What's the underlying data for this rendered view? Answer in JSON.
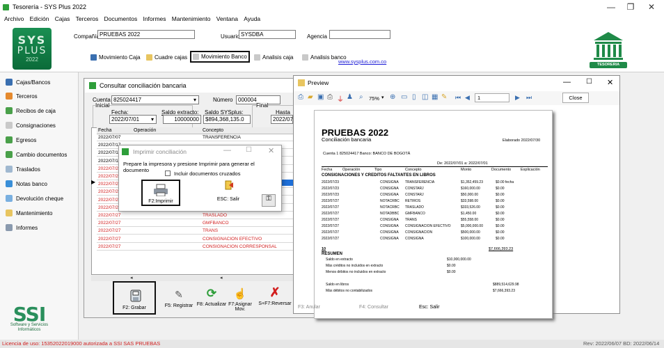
{
  "window": {
    "title": "Tesorería - SYS Plus 2022",
    "minimize": "—",
    "maximize": "❐",
    "close": "✕"
  },
  "menu": [
    "Archivo",
    "Edición",
    "Cajas",
    "Terceros",
    "Documentos",
    "Informes",
    "Mantenimiento",
    "Ventana",
    "Ayuda"
  ],
  "logo": {
    "line1": "SYS",
    "line2": "PLUS",
    "line3": "2022"
  },
  "header": {
    "company_label": "Compañía",
    "company_value": "PRUEBAS 2022",
    "user_label": "Usuario",
    "user_value": "SYSDBA",
    "agency_label": "Agencia",
    "agency_value": "",
    "nav": [
      "Movimiento Caja",
      "Cuadre cajas",
      "Movimiento Banco",
      "Analisis caja",
      "Analisis banco"
    ],
    "website": "www.sysplus.com.co",
    "right_logo": "TESORERIA"
  },
  "sidebar": [
    "Cajas/Bancos",
    "Terceros",
    "Recibos de caja",
    "Consignaciones",
    "Egresos",
    "Cambio documentos",
    "Traslados",
    "Notas banco",
    "Devolución cheque",
    "Mantenimiento",
    "Informes"
  ],
  "ssi": {
    "brand": "SSI",
    "caption": "Software y Servicios Informáticos"
  },
  "status": {
    "left": "Licencia de uso: 15352022019000 autorizada a SSI SAS PRUEBAS",
    "right": "Rev: 2022/06/07 BD: 2022/06/14"
  },
  "conc": {
    "title": "Consultar conciliación bancaria",
    "cuenta_label": "Cuenta",
    "cuenta_value": "825024417",
    "numero_label": "Número",
    "numero_value": "000004",
    "inicial_label": "Inicial",
    "final_label": "Final",
    "fecha_label": "Fecha:",
    "fecha_value": "2022/07/01",
    "saldo_extracto_label": "Saldo extracto:",
    "saldo_extracto_value": "10000000",
    "saldo_sys_label": "Saldo SYSplus:",
    "saldo_sys_value": "$894,368,135.0",
    "hasta_label": "Hasta",
    "hasta_value": "2022/07/",
    "columns": [
      "Fecha",
      "Operación",
      "Concepto"
    ],
    "rows": [
      {
        "fecha": "2022/07/07",
        "concepto": "TRANSFERENCIA",
        "red": false
      },
      {
        "fecha": "2022/07/17",
        "concepto": "",
        "red": false
      },
      {
        "fecha": "2022/07/17",
        "concepto": "",
        "red": false
      },
      {
        "fecha": "2022/07/17",
        "concepto": "",
        "red": false
      },
      {
        "fecha": "2022/07/23",
        "concepto": "",
        "red": true
      },
      {
        "fecha": "2022/07/23",
        "concepto": "",
        "red": true
      },
      {
        "fecha": "2022/07/23",
        "concepto": "",
        "red": true
      },
      {
        "fecha": "2022/07/23",
        "concepto": "",
        "red": true
      },
      {
        "fecha": "2022/07/23",
        "concepto": "CONSTARJ",
        "red": true
      },
      {
        "fecha": "2022/07/27",
        "concepto": "RETIROS",
        "red": true
      },
      {
        "fecha": "2022/07/27",
        "concepto": "TRASLADO",
        "red": true
      },
      {
        "fecha": "2022/07/27",
        "concepto": "GMFBANCO",
        "red": true
      },
      {
        "fecha": "2022/07/27",
        "concepto": "TRANS",
        "red": true
      },
      {
        "fecha": "2022/07/27",
        "concepto": "CONSIGNACION EFECTIVO",
        "red": true
      },
      {
        "fecha": "2022/07/27",
        "concepto": "CONSIGNACION CORRESPONSAL",
        "red": true
      }
    ],
    "buttons": [
      "F2: Grabar",
      "F5: Registrar",
      "F8: Actualizar",
      "F7:Asignar Mov.",
      "S+F7:Reversar"
    ]
  },
  "dialog": {
    "title": "Imprimir conciliación",
    "message": "Prepare la impresora y presione Imprimir para generar el documento",
    "checkbox_label": "Incluir documentos cruzados",
    "print_label": "F2:Imprimir",
    "exit_label": "ESC: Salir"
  },
  "preview": {
    "title": "Preview",
    "zoom": "75%",
    "page_value": "1",
    "close_label": "Close",
    "bottom_buttons": [
      "F3: Anular",
      "F4: Consultar",
      "Esc: Salir"
    ],
    "report": {
      "company": "PRUEBAS 2022",
      "subtitle": "Conciliación bancaria",
      "elaborado": "Elaborado 2022/07/30",
      "cuenta": "Cuenta 1 825024417  Banco: BANCO DE BOGOTÁ",
      "periodo": "De: 2022/07/01 a: 2022/07/01",
      "cols": [
        "Fecha",
        "Operación",
        "Tipo",
        "Concepto",
        "Monto",
        "Documento",
        "Explicación"
      ],
      "section": "CONSIGNACIONES Y CREDITOS FALTANTES EN LIBROS",
      "rows": [
        [
          "2022/07/23",
          "CONSIGNA",
          "TRANSFERENCIA",
          "$1,352,459.23",
          "$0.00 fecha"
        ],
        [
          "2022/07/23",
          "CONSIGNA",
          "CONSTARJ",
          "$160,000.00",
          "$0.00"
        ],
        [
          "2022/07/23",
          "CONSIGNA",
          "CONSTARJ",
          "$50,000.00",
          "$0.00"
        ],
        [
          "2022/07/27",
          "NOTACRBC",
          "RETIROS",
          "$33,598.00",
          "$0.00"
        ],
        [
          "2022/07/27",
          "NOTACRBC",
          "TRASLADO",
          "$333,526.00",
          "$0.00"
        ],
        [
          "2022/07/27",
          "NOTADBBC",
          "GMFBANCO",
          "$1,450.00",
          "$0.00"
        ],
        [
          "2022/07/27",
          "CONSIGNA",
          "TRANS",
          "$55,558.00",
          "$0.00"
        ],
        [
          "2022/07/27",
          "CONSIGNA",
          "CONSIGNACION EFECTIVO",
          "$5,000,000.00",
          "$0.00"
        ],
        [
          "2022/07/27",
          "CONSIGNA",
          "CONSIGNACION",
          "$500,000.00",
          "$0.00"
        ],
        [
          "2022/07/27",
          "CONSIGNA",
          "CONSIGNA",
          "$100,000.00",
          "$0.00"
        ]
      ],
      "count": "10",
      "total": "$7,666,393.23",
      "resumen_title": "RESUMEN",
      "resumen": [
        [
          "Saldo en extracto",
          "$10,000,000.00"
        ],
        [
          "Más créditos no incluidos en extracto",
          "$0.00"
        ],
        [
          "Menos débitos no incluidos en extracto",
          "$0.00"
        ],
        [
          "Saldo en libros",
          "$889,514,629.98"
        ],
        [
          "Más débitos no contabilizados",
          "$7,666,393.23"
        ]
      ]
    }
  }
}
